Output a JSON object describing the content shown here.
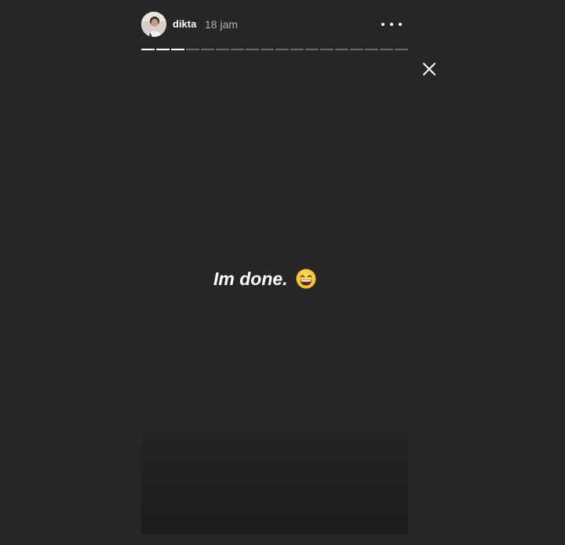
{
  "story": {
    "user": {
      "username": "dikta",
      "time": "18 jam",
      "avatar_icon": "user-avatar"
    },
    "more_icon": "more-horizontal-icon",
    "close_icon": "close-icon",
    "progress": {
      "total_segments": 18,
      "completed_segments": 3
    },
    "caption": {
      "text": "Im done.",
      "emoji_icon": "grinning-face-emoji"
    }
  }
}
